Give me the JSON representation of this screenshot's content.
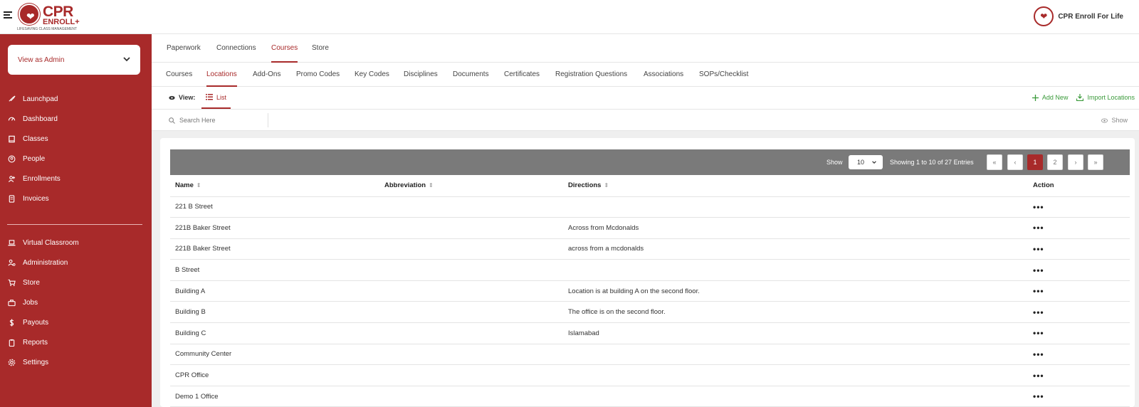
{
  "header": {
    "logo_main": "CPR",
    "logo_sub": "ENROLL+",
    "logo_tagline": "LIFESAVING CLASS MANAGEMENT",
    "org_name": "CPR Enroll For Life"
  },
  "sidebar": {
    "role_select": "View as Admin",
    "items_top": [
      {
        "label": "Launchpad",
        "icon": "rocket-icon"
      },
      {
        "label": "Dashboard",
        "icon": "gauge-icon"
      },
      {
        "label": "Classes",
        "icon": "book-icon"
      },
      {
        "label": "People",
        "icon": "user-circle-icon"
      },
      {
        "label": "Enrollments",
        "icon": "user-plus-icon"
      },
      {
        "label": "Invoices",
        "icon": "invoice-icon"
      }
    ],
    "items_bottom": [
      {
        "label": "Virtual Classroom",
        "icon": "laptop-icon"
      },
      {
        "label": "Administration",
        "icon": "users-cog-icon"
      },
      {
        "label": "Store",
        "icon": "cart-icon"
      },
      {
        "label": "Jobs",
        "icon": "briefcase-icon"
      },
      {
        "label": "Payouts",
        "icon": "dollar-icon"
      },
      {
        "label": "Reports",
        "icon": "clipboard-icon"
      },
      {
        "label": "Settings",
        "icon": "gear-icon"
      }
    ]
  },
  "tabs_primary": [
    "Paperwork",
    "Connections",
    "Courses",
    "Store"
  ],
  "tabs_primary_active": "Courses",
  "tabs_secondary": [
    "Courses",
    "Locations",
    "Add-Ons",
    "Promo Codes",
    "Key Codes",
    "Disciplines",
    "Documents",
    "Certificates",
    "Registration Questions",
    "Associations",
    "SOPs/Checklist"
  ],
  "tabs_secondary_active": "Locations",
  "view": {
    "label": "View:",
    "list_label": "List",
    "add_new": "Add New",
    "import": "Import Locations"
  },
  "search": {
    "placeholder": "Search Here",
    "show_label": "Show"
  },
  "pagination": {
    "show_label": "Show",
    "page_size": "10",
    "info": "Showing 1 to 10 of 27 Entries",
    "first": "«",
    "prev": "‹",
    "pages": [
      "1",
      "2"
    ],
    "current": "1",
    "next": "›",
    "last": "»"
  },
  "table": {
    "columns": [
      "Name",
      "Abbreviation",
      "Directions",
      "Action"
    ],
    "rows": [
      {
        "name": "221 B Street",
        "abbreviation": "",
        "directions": ""
      },
      {
        "name": "221B Baker Street",
        "abbreviation": "",
        "directions": "Across from Mcdonalds"
      },
      {
        "name": "221B Baker Street",
        "abbreviation": "",
        "directions": "across from a mcdonalds"
      },
      {
        "name": "B Street",
        "abbreviation": "",
        "directions": ""
      },
      {
        "name": "Building A",
        "abbreviation": "",
        "directions": "Location is at building A on the second floor."
      },
      {
        "name": "Building B",
        "abbreviation": "",
        "directions": "The office is on the second floor."
      },
      {
        "name": "Building C",
        "abbreviation": "",
        "directions": "Islamabad"
      },
      {
        "name": "Community Center",
        "abbreviation": "",
        "directions": ""
      },
      {
        "name": "CPR Office",
        "abbreviation": "",
        "directions": ""
      },
      {
        "name": "Demo 1 Office",
        "abbreviation": "",
        "directions": ""
      }
    ],
    "action_label": "•••"
  },
  "colors": {
    "brand": "#a82a2a",
    "accent_green": "#3a9a3a",
    "table_header_bar": "#7a7a7a"
  }
}
